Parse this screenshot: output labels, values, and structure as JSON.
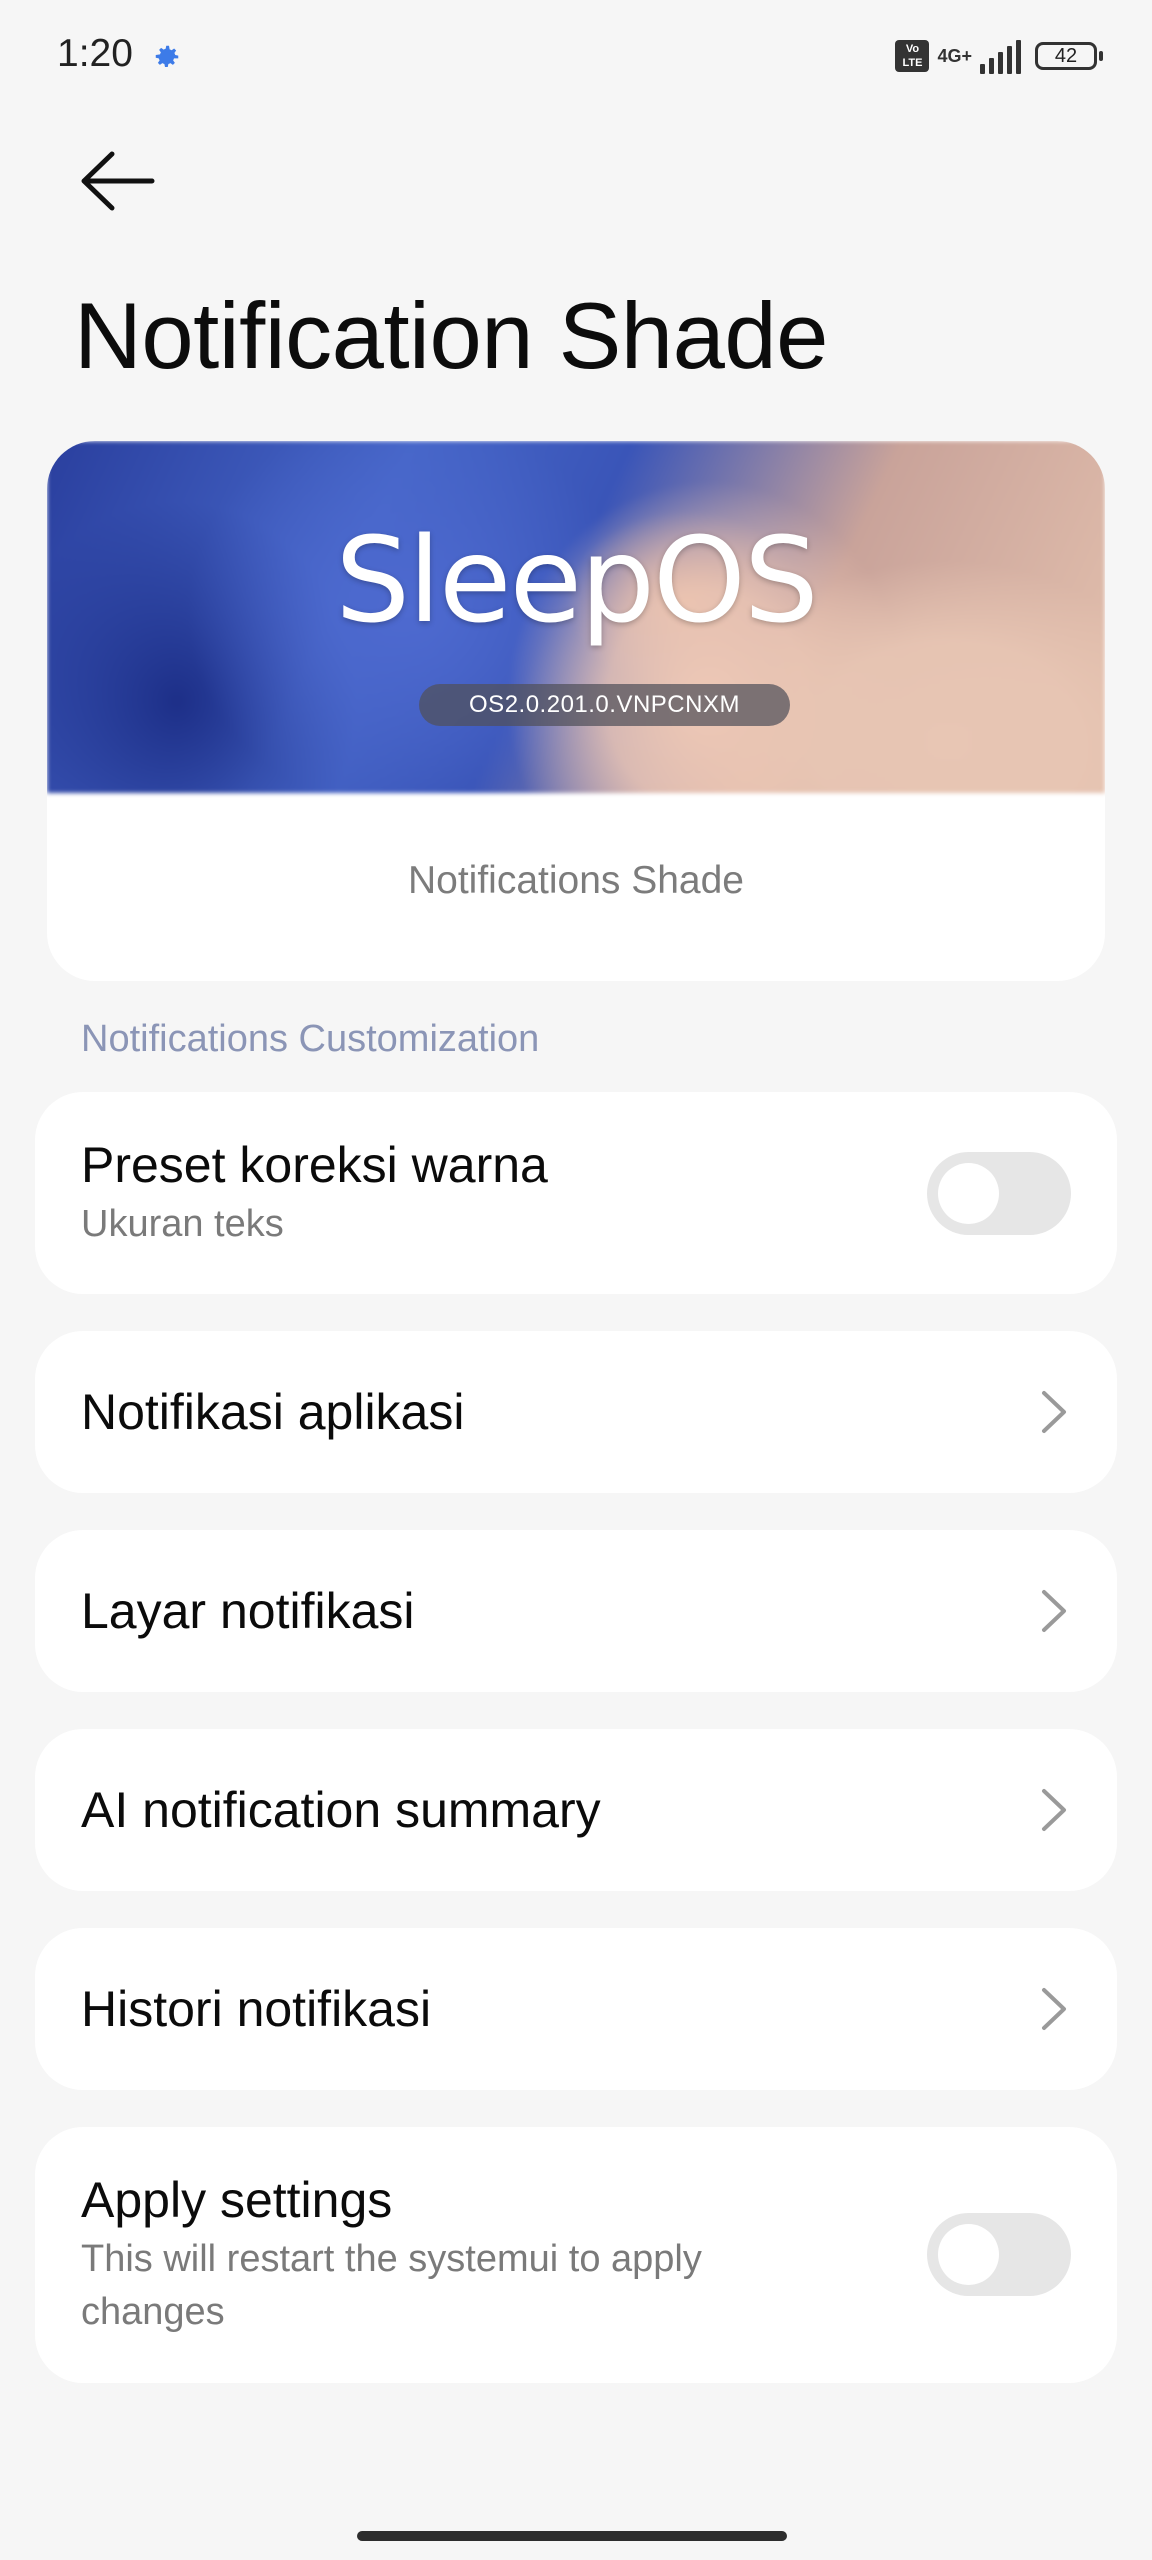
{
  "status_bar": {
    "time": "1:20",
    "volte": "Vo LTE",
    "network": "4G+",
    "battery": "42"
  },
  "header": {
    "title": "Notification Shade"
  },
  "banner": {
    "brand": "SleepOS",
    "version": "OS2.0.201.0.VNPCNXM",
    "caption": "Notifications Shade"
  },
  "section": {
    "label": "Notifications Customization"
  },
  "items": [
    {
      "title": "Preset koreksi warna",
      "subtitle": "Ukuran teks",
      "toggle": false
    },
    {
      "title": "Notifikasi aplikasi"
    },
    {
      "title": "Layar notifikasi"
    },
    {
      "title": "AI notification summary"
    },
    {
      "title": "Histori notifikasi"
    },
    {
      "title": "Apply settings",
      "subtitle": "This will restart the systemui to apply changes",
      "toggle": false
    }
  ],
  "colors": {
    "background": "#f6f6f6",
    "section_label": "#8b95b6",
    "toggle_off": "#e6e6e6",
    "accent_gear": "#3d7be8"
  }
}
